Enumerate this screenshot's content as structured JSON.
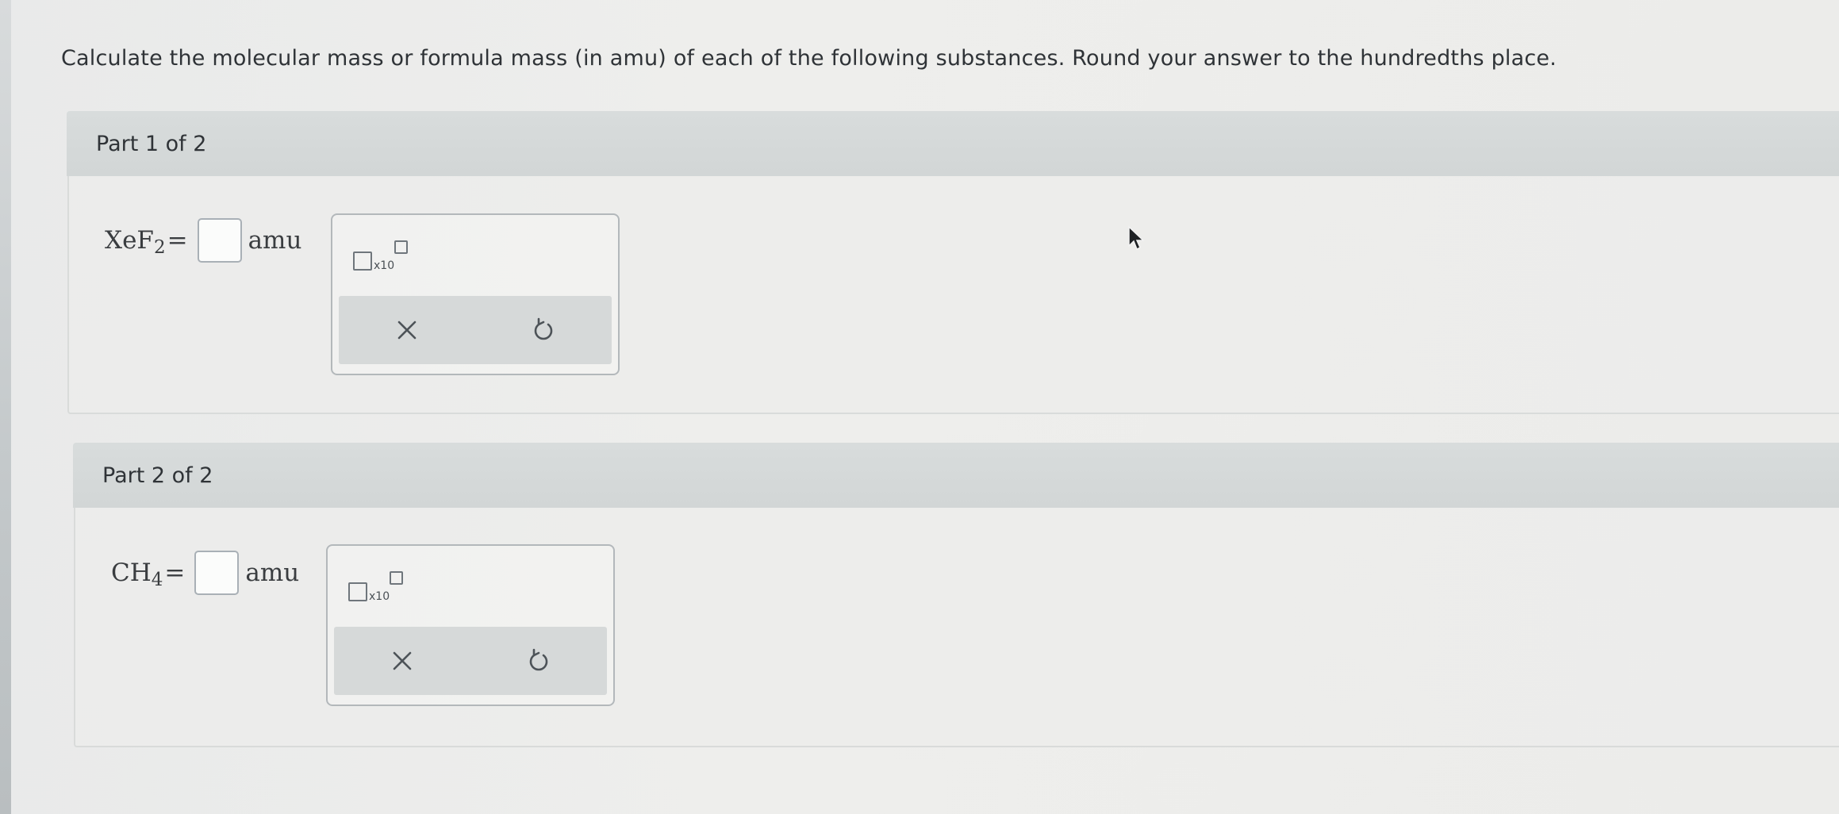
{
  "question": "Calculate the molecular mass or formula mass (in amu) of each of the following substances. Round your answer to the hundredths place.",
  "parts": [
    {
      "title": "Part 1 of 2",
      "formula_base": "XeF",
      "formula_sub": "2",
      "equals": "=",
      "answer_value": "",
      "unit": "amu",
      "sci_notation_label": "x10"
    },
    {
      "title": "Part 2 of 2",
      "formula_base": "CH",
      "formula_sub": "4",
      "equals": "=",
      "answer_value": "",
      "unit": "amu",
      "sci_notation_label": "x10"
    }
  ],
  "icons": {
    "clear": "close-icon",
    "reset": "undo-icon",
    "scientific_notation": "scientific-notation-icon",
    "cursor": "mouse-pointer-icon"
  },
  "colors": {
    "header_bg": "#d4d8d8",
    "toolbar_bg": "#d6d9d9",
    "input_border": "#a9b0b6"
  }
}
